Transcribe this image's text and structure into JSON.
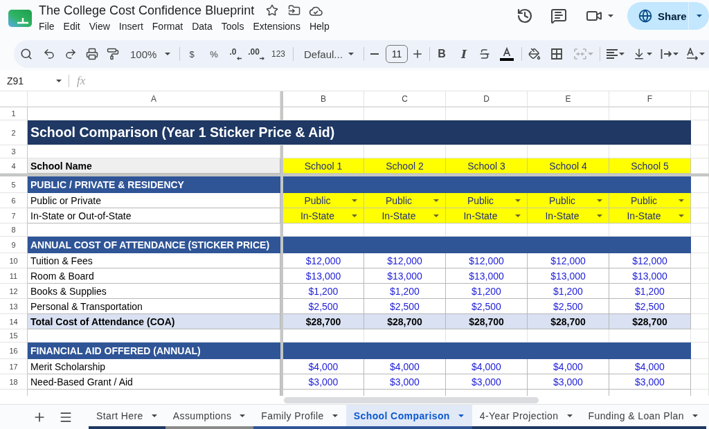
{
  "app": {
    "title": "The College Cost Confidence Blueprint",
    "menu": [
      "File",
      "Edit",
      "View",
      "Insert",
      "Format",
      "Data",
      "Tools",
      "Extensions",
      "Help"
    ],
    "share_label": "Share"
  },
  "toolbar": {
    "zoom": "100%",
    "currency": "$",
    "percent": "%",
    "decrease_decimals": ".0",
    "increase_decimals": ".00",
    "number_format": "123",
    "font": "Defaul...",
    "font_size": "11",
    "bold": "B",
    "italic": "I",
    "merge": {
      "disabled": true
    }
  },
  "formula_bar": {
    "cell_ref": "Z91",
    "fx": "fx"
  },
  "sheet": {
    "columns": [
      "A",
      "B",
      "C",
      "D",
      "E",
      "F"
    ],
    "rows": [
      {
        "number": "1",
        "kind": "blank"
      },
      {
        "number": "2",
        "kind": "title",
        "label": "School Comparison (Year 1 Sticker Price & Aid)"
      },
      {
        "number": "3",
        "kind": "blank"
      },
      {
        "number": "4",
        "kind": "header",
        "label": "School Name",
        "values": [
          "School 1",
          "School 2",
          "School 3",
          "School 4",
          "School 5"
        ]
      },
      {
        "number": "5",
        "kind": "section",
        "label": "PUBLIC / PRIVATE & RESIDENCY"
      },
      {
        "number": "6",
        "kind": "dropdown",
        "label": "Public or Private",
        "values": [
          "Public",
          "Public",
          "Public",
          "Public",
          "Public"
        ]
      },
      {
        "number": "7",
        "kind": "dropdown",
        "label": "In-State or Out-of-State",
        "values": [
          "In-State",
          "In-State",
          "In-State",
          "In-State",
          "In-State"
        ]
      },
      {
        "number": "8",
        "kind": "blank"
      },
      {
        "number": "9",
        "kind": "section",
        "label": "ANNUAL COST OF ATTENDANCE (STICKER PRICE)"
      },
      {
        "number": "10",
        "kind": "input",
        "label": "Tuition & Fees",
        "values": [
          "$12,000",
          "$12,000",
          "$12,000",
          "$12,000",
          "$12,000"
        ]
      },
      {
        "number": "11",
        "kind": "input",
        "label": "Room & Board",
        "values": [
          "$13,000",
          "$13,000",
          "$13,000",
          "$13,000",
          "$13,000"
        ]
      },
      {
        "number": "12",
        "kind": "input",
        "label": "Books & Supplies",
        "values": [
          "$1,200",
          "$1,200",
          "$1,200",
          "$1,200",
          "$1,200"
        ]
      },
      {
        "number": "13",
        "kind": "input",
        "label": "Personal & Transportation",
        "values": [
          "$2,500",
          "$2,500",
          "$2,500",
          "$2,500",
          "$2,500"
        ]
      },
      {
        "number": "14",
        "kind": "total",
        "label": "Total Cost of Attendance (COA)",
        "values": [
          "$28,700",
          "$28,700",
          "$28,700",
          "$28,700",
          "$28,700"
        ]
      },
      {
        "number": "15",
        "kind": "blank"
      },
      {
        "number": "16",
        "kind": "section",
        "label": "FINANCIAL AID OFFERED (ANNUAL)"
      },
      {
        "number": "17",
        "kind": "input",
        "label": "Merit Scholarship",
        "values": [
          "$4,000",
          "$4,000",
          "$4,000",
          "$4,000",
          "$4,000"
        ]
      },
      {
        "number": "18",
        "kind": "input",
        "label": "Need-Based Grant / Aid",
        "values": [
          "$3,000",
          "$3,000",
          "$3,000",
          "$3,000",
          "$3,000"
        ]
      }
    ]
  },
  "sheet_tabs": [
    {
      "label": "Start Here",
      "selected": false,
      "color": "#1f3864"
    },
    {
      "label": "Assumptions",
      "selected": false,
      "color": "#8a8a8a"
    },
    {
      "label": "Family Profile",
      "selected": false,
      "color": "#2f5597"
    },
    {
      "label": "School Comparison",
      "selected": true,
      "color": "#2f5597"
    },
    {
      "label": "4-Year Projection",
      "selected": false,
      "color": "#1f3864"
    },
    {
      "label": "Funding & Loan Plan",
      "selected": false,
      "color": "#1f3864"
    }
  ]
}
